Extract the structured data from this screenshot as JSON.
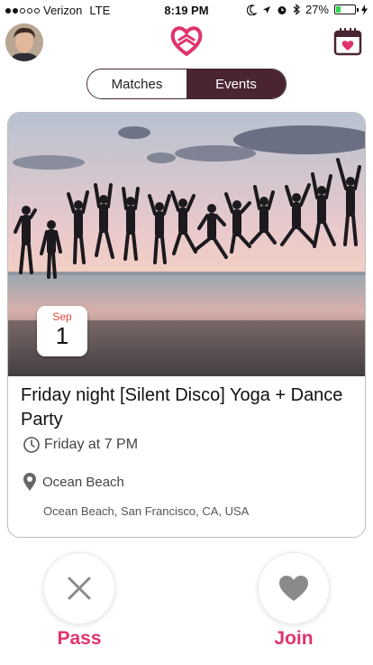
{
  "status_bar": {
    "carrier": "Verizon",
    "network": "LTE",
    "time": "8:19 PM",
    "battery": "27%",
    "battery_level": 0.27,
    "signal_bars": 2,
    "icons": [
      "moon-icon",
      "location-arrow-icon",
      "alarm-icon",
      "bluetooth-icon",
      "charging-bolt-icon"
    ]
  },
  "header": {
    "avatar_icon": "profile-avatar",
    "logo_icon": "heart-swirl-logo",
    "calendar_icon": "calendar-heart-icon",
    "accent_color": "#e0336e",
    "brand_dark": "#4a2433"
  },
  "tabs": {
    "items": [
      {
        "label": "Matches",
        "selected": false
      },
      {
        "label": "Events",
        "selected": true
      }
    ]
  },
  "event": {
    "month": "Sep",
    "day": "1",
    "title": "Friday night [Silent Disco] Yoga + Dance Party",
    "time": "Friday at 7 PM",
    "venue": "Ocean Beach",
    "address": "Ocean Beach, San Francisco, CA, USA",
    "time_icon": "clock-icon",
    "venue_icon": "location-pin-icon"
  },
  "actions": {
    "pass_label": "Pass",
    "join_label": "Join",
    "pass_icon": "close-x-icon",
    "join_icon": "heart-icon"
  }
}
